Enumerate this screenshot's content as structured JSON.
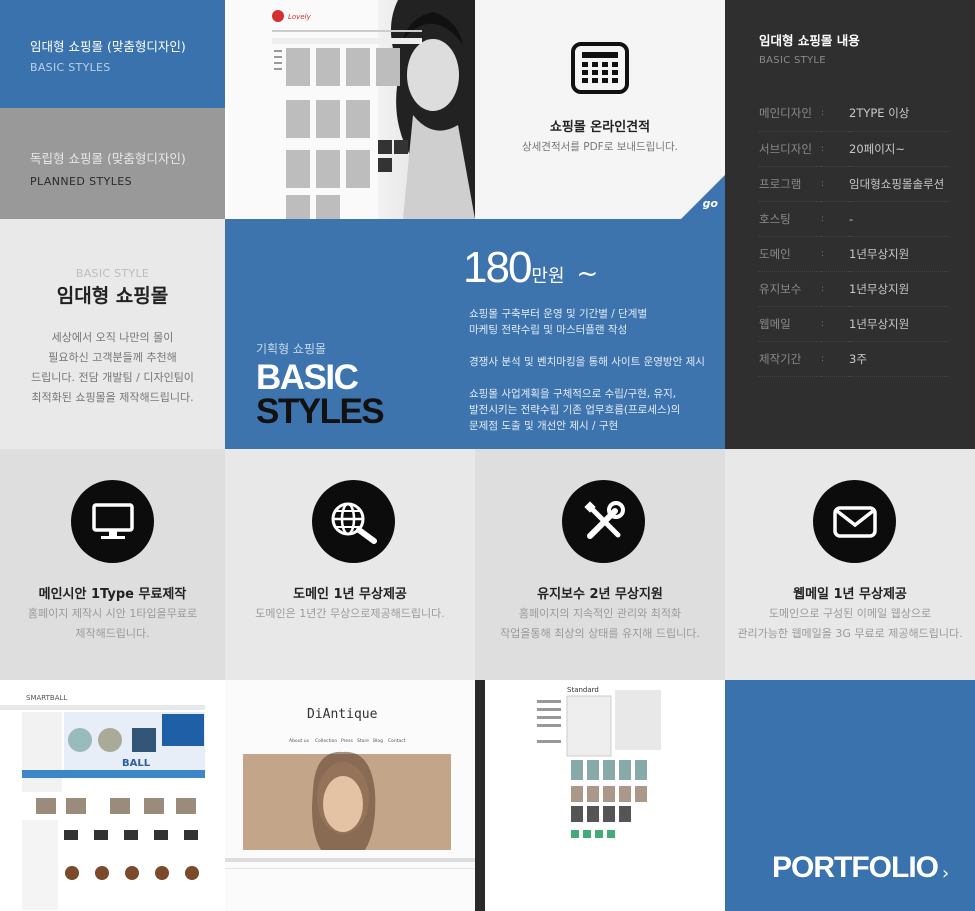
{
  "tabs": [
    {
      "title": "임대형 쇼핑몰 (맞춤형디자인)",
      "sub": "BASIC STYLES"
    },
    {
      "title": "독립형 쇼핑몰  (맞춤형디자인)",
      "sub": "PLANNED  STYLES"
    }
  ],
  "estimate": {
    "title": "쇼핑몰 온라인견적",
    "desc": "상세견적서를 PDF로 보내드립니다.",
    "go": "go"
  },
  "spec": {
    "title": "임대형 쇼핑몰 내용",
    "sub": "BASIC  STYLE",
    "rows": [
      {
        "k": "메인디자인",
        "v": "2TYPE 이상"
      },
      {
        "k": "서브디자인",
        "v": "20페이지~"
      },
      {
        "k": "프로그램",
        "v": "임대형쇼핑몰솔루션"
      },
      {
        "k": "호스팅",
        "v": "-"
      },
      {
        "k": "도메인",
        "v": "1년무상지원"
      },
      {
        "k": "유지보수",
        "v": "1년무상지원"
      },
      {
        "k": "웹메일",
        "v": "1년무상지원"
      },
      {
        "k": "제작기간",
        "v": "3주"
      }
    ],
    "sep": ":"
  },
  "intro": {
    "sub": "BASIC STYLE",
    "title": "임대형 쇼핑몰",
    "desc": [
      "세상에서 오직 나만의 몰이",
      "필요하신 고객분들께  추천해",
      "드립니다.  전담 개발팀 / 디자인팀이",
      "최적화된 쇼핑몰을 제작해드립니다."
    ]
  },
  "basic": {
    "small": "기획형 쇼핑몰",
    "big1": "BASIC",
    "big2": "STYLES",
    "price_num": "180",
    "price_unit": "만원",
    "price_tilde": "~",
    "desc": [
      [
        "쇼핑몰 구축부터 운영 및 기간별 / 단계별",
        "마케팅 전략수립 및 마스터플랜 작성"
      ],
      [
        "경쟁사 분석 및 벤치마킹을 통해 사이트 운영방안 제시"
      ],
      [
        "쇼핑몰 사업계획을 구체적으로 수립/구현, 유지,",
        "발전시키는 전략수립 기존 업무흐름(프로세스)의",
        "문제점 도출 및 개선안 제시 / 구현"
      ]
    ]
  },
  "services": [
    {
      "icon": "monitor-icon",
      "title": "메인시안 1Type 무료제작",
      "desc": [
        "홈페이지 제작시 시안 1타입을무료로",
        "제작해드립니다."
      ]
    },
    {
      "icon": "globe-search-icon",
      "title": "도메인 1년 무상제공",
      "desc": [
        "도메인은 1년간 무상으로제공해드립니다."
      ]
    },
    {
      "icon": "tools-icon",
      "title": "유지보수 2년 무상지원",
      "desc": [
        "홈페이지의 지속적인 관리와 최적화",
        "작업을통해 최상의 상태를 유지해 드립니다."
      ]
    },
    {
      "icon": "mail-icon",
      "title": "웹메일 1년 무상제공",
      "desc": [
        "도메인으로 구성된 이메일 웹상으로",
        "관리가능한 웹메일을 3G 무료로 제공해드립니다."
      ]
    }
  ],
  "portfolio": {
    "label": "PORTFOLIO",
    "arrow": "›",
    "shots": [
      {
        "brand": "SMARTBALL",
        "banner": "BALL"
      },
      {
        "brand": "DiAntique",
        "nav": [
          "About us",
          "Collection",
          "Press",
          "Store",
          "Blog",
          "Contact"
        ]
      },
      {
        "brand": "Standard"
      }
    ]
  },
  "shot1": {
    "logo": "Lovely"
  }
}
